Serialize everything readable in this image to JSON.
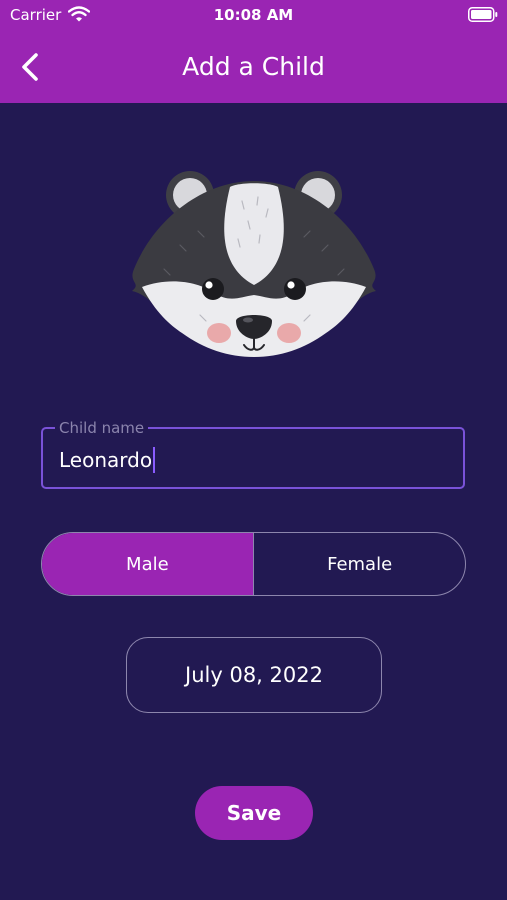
{
  "status_bar": {
    "carrier": "Carrier",
    "time": "10:08 AM"
  },
  "header": {
    "title": "Add a Child",
    "back_icon": "chevron-left-icon"
  },
  "avatar": {
    "icon": "badger-avatar-icon"
  },
  "form": {
    "name_label": "Child name",
    "name_value": "Leonardo",
    "gender": {
      "options": [
        "Male",
        "Female"
      ],
      "selected": "Male"
    },
    "date_value": "July 08, 2022",
    "save_label": "Save"
  },
  "colors": {
    "background": "#221952",
    "header": "#9a25b3",
    "accent": "#9a25b3",
    "field_border": "#7a52d8",
    "muted_border": "#8d86ad"
  }
}
